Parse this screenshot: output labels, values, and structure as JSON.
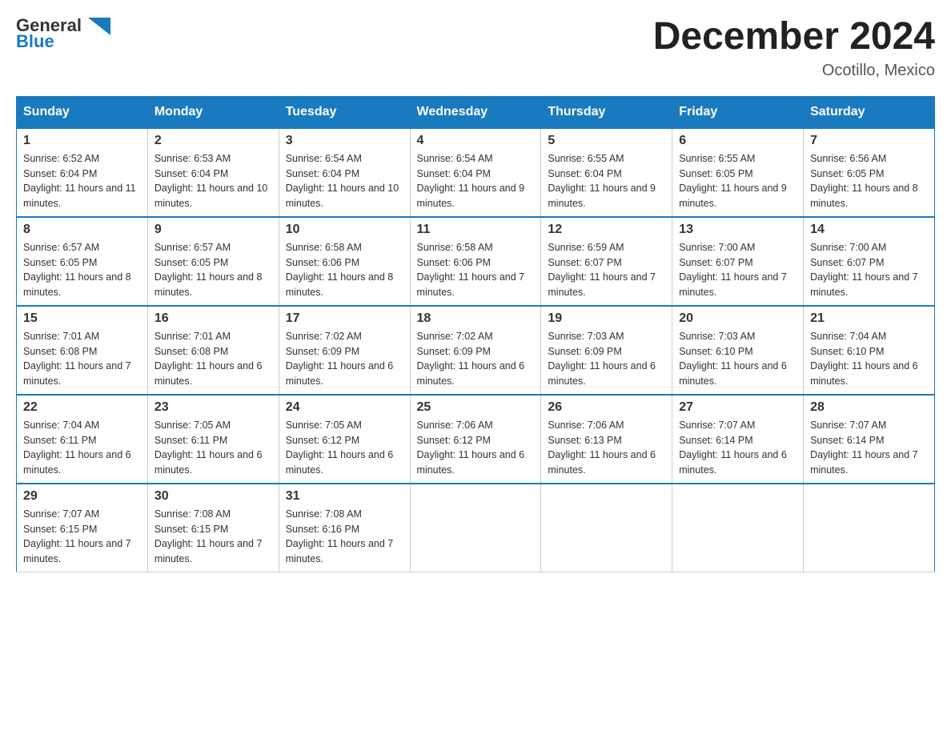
{
  "header": {
    "logo_general": "General",
    "logo_blue": "Blue",
    "month_title": "December 2024",
    "location": "Ocotillo, Mexico"
  },
  "days_of_week": [
    "Sunday",
    "Monday",
    "Tuesday",
    "Wednesday",
    "Thursday",
    "Friday",
    "Saturday"
  ],
  "weeks": [
    [
      {
        "num": "1",
        "sunrise": "6:52 AM",
        "sunset": "6:04 PM",
        "daylight": "11 hours and 11 minutes."
      },
      {
        "num": "2",
        "sunrise": "6:53 AM",
        "sunset": "6:04 PM",
        "daylight": "11 hours and 10 minutes."
      },
      {
        "num": "3",
        "sunrise": "6:54 AM",
        "sunset": "6:04 PM",
        "daylight": "11 hours and 10 minutes."
      },
      {
        "num": "4",
        "sunrise": "6:54 AM",
        "sunset": "6:04 PM",
        "daylight": "11 hours and 9 minutes."
      },
      {
        "num": "5",
        "sunrise": "6:55 AM",
        "sunset": "6:04 PM",
        "daylight": "11 hours and 9 minutes."
      },
      {
        "num": "6",
        "sunrise": "6:55 AM",
        "sunset": "6:05 PM",
        "daylight": "11 hours and 9 minutes."
      },
      {
        "num": "7",
        "sunrise": "6:56 AM",
        "sunset": "6:05 PM",
        "daylight": "11 hours and 8 minutes."
      }
    ],
    [
      {
        "num": "8",
        "sunrise": "6:57 AM",
        "sunset": "6:05 PM",
        "daylight": "11 hours and 8 minutes."
      },
      {
        "num": "9",
        "sunrise": "6:57 AM",
        "sunset": "6:05 PM",
        "daylight": "11 hours and 8 minutes."
      },
      {
        "num": "10",
        "sunrise": "6:58 AM",
        "sunset": "6:06 PM",
        "daylight": "11 hours and 8 minutes."
      },
      {
        "num": "11",
        "sunrise": "6:58 AM",
        "sunset": "6:06 PM",
        "daylight": "11 hours and 7 minutes."
      },
      {
        "num": "12",
        "sunrise": "6:59 AM",
        "sunset": "6:07 PM",
        "daylight": "11 hours and 7 minutes."
      },
      {
        "num": "13",
        "sunrise": "7:00 AM",
        "sunset": "6:07 PM",
        "daylight": "11 hours and 7 minutes."
      },
      {
        "num": "14",
        "sunrise": "7:00 AM",
        "sunset": "6:07 PM",
        "daylight": "11 hours and 7 minutes."
      }
    ],
    [
      {
        "num": "15",
        "sunrise": "7:01 AM",
        "sunset": "6:08 PM",
        "daylight": "11 hours and 7 minutes."
      },
      {
        "num": "16",
        "sunrise": "7:01 AM",
        "sunset": "6:08 PM",
        "daylight": "11 hours and 6 minutes."
      },
      {
        "num": "17",
        "sunrise": "7:02 AM",
        "sunset": "6:09 PM",
        "daylight": "11 hours and 6 minutes."
      },
      {
        "num": "18",
        "sunrise": "7:02 AM",
        "sunset": "6:09 PM",
        "daylight": "11 hours and 6 minutes."
      },
      {
        "num": "19",
        "sunrise": "7:03 AM",
        "sunset": "6:09 PM",
        "daylight": "11 hours and 6 minutes."
      },
      {
        "num": "20",
        "sunrise": "7:03 AM",
        "sunset": "6:10 PM",
        "daylight": "11 hours and 6 minutes."
      },
      {
        "num": "21",
        "sunrise": "7:04 AM",
        "sunset": "6:10 PM",
        "daylight": "11 hours and 6 minutes."
      }
    ],
    [
      {
        "num": "22",
        "sunrise": "7:04 AM",
        "sunset": "6:11 PM",
        "daylight": "11 hours and 6 minutes."
      },
      {
        "num": "23",
        "sunrise": "7:05 AM",
        "sunset": "6:11 PM",
        "daylight": "11 hours and 6 minutes."
      },
      {
        "num": "24",
        "sunrise": "7:05 AM",
        "sunset": "6:12 PM",
        "daylight": "11 hours and 6 minutes."
      },
      {
        "num": "25",
        "sunrise": "7:06 AM",
        "sunset": "6:12 PM",
        "daylight": "11 hours and 6 minutes."
      },
      {
        "num": "26",
        "sunrise": "7:06 AM",
        "sunset": "6:13 PM",
        "daylight": "11 hours and 6 minutes."
      },
      {
        "num": "27",
        "sunrise": "7:07 AM",
        "sunset": "6:14 PM",
        "daylight": "11 hours and 6 minutes."
      },
      {
        "num": "28",
        "sunrise": "7:07 AM",
        "sunset": "6:14 PM",
        "daylight": "11 hours and 7 minutes."
      }
    ],
    [
      {
        "num": "29",
        "sunrise": "7:07 AM",
        "sunset": "6:15 PM",
        "daylight": "11 hours and 7 minutes."
      },
      {
        "num": "30",
        "sunrise": "7:08 AM",
        "sunset": "6:15 PM",
        "daylight": "11 hours and 7 minutes."
      },
      {
        "num": "31",
        "sunrise": "7:08 AM",
        "sunset": "6:16 PM",
        "daylight": "11 hours and 7 minutes."
      },
      null,
      null,
      null,
      null
    ]
  ],
  "labels": {
    "sunrise": "Sunrise:",
    "sunset": "Sunset:",
    "daylight": "Daylight:"
  }
}
